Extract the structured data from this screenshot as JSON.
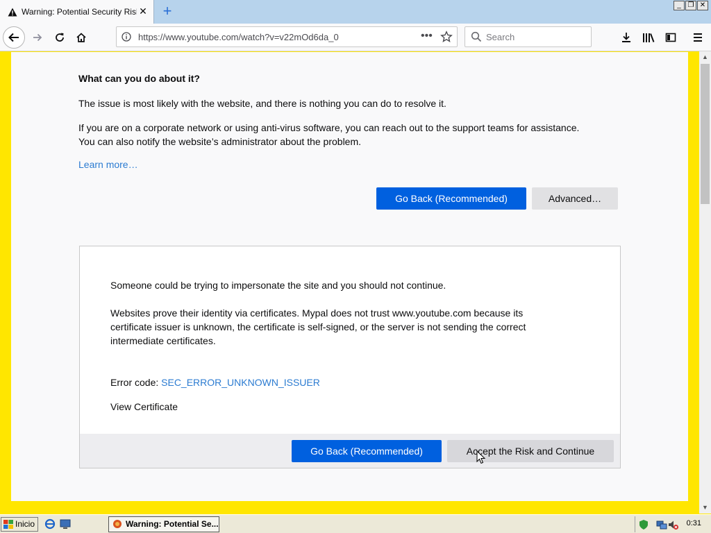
{
  "tab": {
    "title": "Warning: Potential Security Risk"
  },
  "nav": {
    "url": "https://www.youtube.com/watch?v=v22mOd6da_0",
    "search_placeholder": "Search"
  },
  "page": {
    "heading": "What can you do about it?",
    "para1": "The issue is most likely with the website, and there is nothing you can do to resolve it.",
    "para2_line1": "If you are on a corporate network or using anti-virus software, you can reach out to the support teams for assistance.",
    "para2_line2": "You can also notify the website’s administrator about the problem.",
    "learn_more": "Learn more…",
    "go_back": "Go Back (Recommended)",
    "advanced": "Advanced…"
  },
  "panel": {
    "line1": "Someone could be trying to impersonate the site and you should not continue.",
    "cert_line1": "Websites prove their identity via certificates. Mypal does not trust www.youtube.com because its",
    "cert_line2": "certificate issuer is unknown, the certificate is self-signed, or the server is not sending the correct",
    "cert_line3": "intermediate certificates.",
    "error_label": "Error code: ",
    "error_code": "SEC_ERROR_UNKNOWN_ISSUER",
    "view_cert": "View Certificate",
    "go_back": "Go Back (Recommended)",
    "accept": "Accept the Risk and Continue"
  },
  "taskbar": {
    "start_label": "Inicio",
    "task_title": "Warning: Potential Se...",
    "clock": "0:31"
  },
  "colors": {
    "primary": "#0060df",
    "link": "#2b7bd1",
    "frame": "#ffe600"
  }
}
